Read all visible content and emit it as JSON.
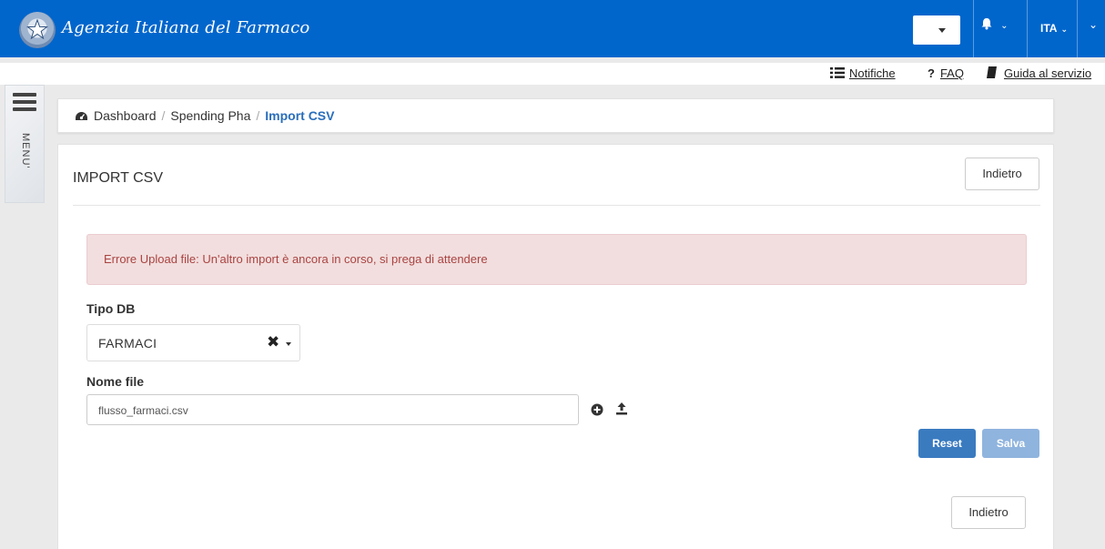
{
  "app": {
    "brand_text": "Agenzia Italiana del Farmaco",
    "language": "ITA",
    "brand_color": "#0066cc"
  },
  "top_links": {
    "notifications": "Notifiche",
    "faq": "FAQ",
    "guide": "Guida al servizio"
  },
  "side_menu": {
    "label": "MENU'"
  },
  "breadcrumb": {
    "home": "Dashboard",
    "section": "Spending Pha",
    "current": "Import CSV"
  },
  "page": {
    "title": "IMPORT CSV",
    "back_label": "Indietro",
    "alert": "Errore Upload file: Un'altro import è ancora in corso, si prega di attendere",
    "db_label": "Tipo DB",
    "db_value": "FARMACI",
    "file_label": "Nome file",
    "file_value": "flusso_farmaci.csv",
    "reset_label": "Reset",
    "save_label": "Salva"
  },
  "icons": {
    "dashboard": "dashboard-icon",
    "bell": "bell-icon",
    "list": "list-icon",
    "question": "question-icon",
    "book": "book-icon",
    "clear": "clear-icon",
    "add": "plus-circle-icon",
    "upload": "upload-icon"
  }
}
